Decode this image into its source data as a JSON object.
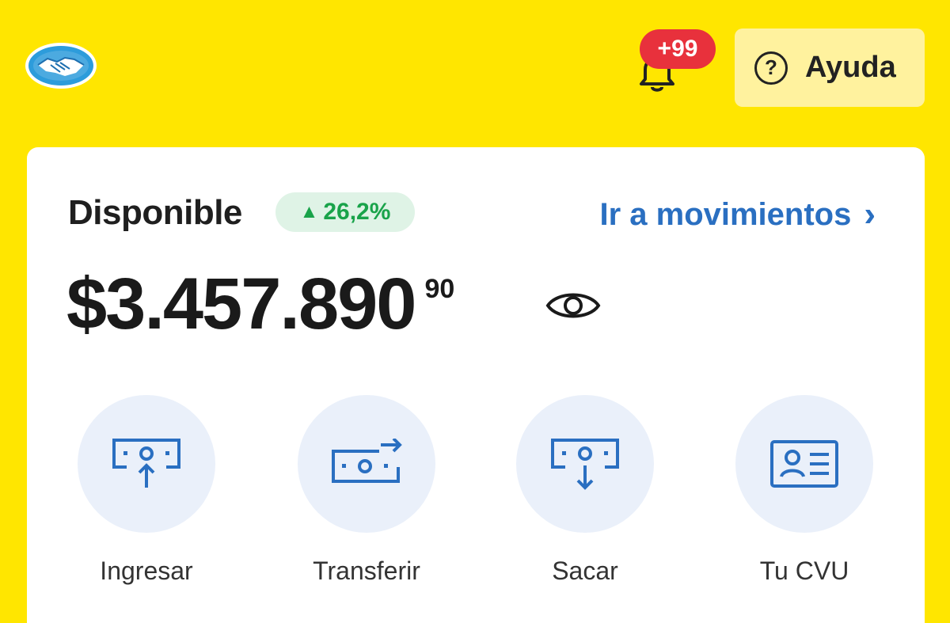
{
  "header": {
    "notifications_badge": "+99",
    "help_label": "Ayuda",
    "help_icon_glyph": "?"
  },
  "account": {
    "title": "Disponible",
    "change_arrow": "▲",
    "change_pct": "26,2%",
    "movements_link": "Ir a movimientos",
    "movements_chevron": "›",
    "balance_main": "$3.457.890",
    "balance_cents": "90"
  },
  "actions": [
    {
      "label": "Ingresar",
      "icon": "deposit-icon"
    },
    {
      "label": "Transferir",
      "icon": "transfer-icon"
    },
    {
      "label": "Sacar",
      "icon": "withdraw-icon"
    },
    {
      "label": "Tu CVU",
      "icon": "id-card-icon"
    }
  ],
  "colors": {
    "background": "#FFE600",
    "link": "#2A6FC1",
    "positive": "#19A34A",
    "badge": "#E8313C",
    "icon_blue": "#2A6FC1"
  }
}
